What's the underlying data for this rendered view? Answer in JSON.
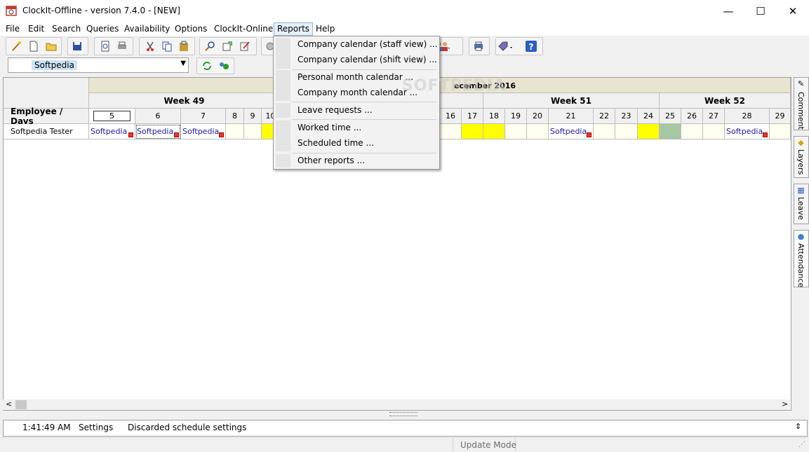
{
  "window": {
    "title": "ClockIt-Offline - version  7.4.0 - [NEW]",
    "minimize": "—",
    "maximize": "☐",
    "close": "✕"
  },
  "menu": [
    "File",
    "Edit",
    "Search",
    "Queries",
    "Availability",
    "Options",
    "ClockIt-Online",
    "Reports",
    "Help"
  ],
  "toolbar_icons": [
    "wand-icon",
    "new-file-icon",
    "open-folder-icon",
    "save-icon",
    "preview-icon",
    "print-icon",
    "cut-icon",
    "copy-icon",
    "paste-icon",
    "find-icon",
    "export-icon",
    "edit-icon",
    "settings-icon",
    "users-icon",
    "printer-icon",
    "tags-icon",
    "help-icon"
  ],
  "employee_selector": {
    "value": "Softpedia"
  },
  "grid": {
    "month_label": "ecember 2016",
    "weeks": [
      "Week 49",
      "Week 51",
      "Week 52"
    ],
    "row_header": "Employee / Days",
    "employee": "Softpedia Tester",
    "days_left": [
      "5",
      "6",
      "7",
      "8",
      "9",
      "10"
    ],
    "days_right": [
      "16",
      "17",
      "18",
      "19",
      "20",
      "21",
      "22",
      "23",
      "24",
      "25",
      "26",
      "27",
      "28",
      "29"
    ],
    "entry": "Softpedia"
  },
  "side_tabs": [
    "Comment",
    "Layers",
    "Leave",
    "Attendance"
  ],
  "reports_menu": [
    "Company calendar (staff view) ...",
    "Company calendar (shift view) ...",
    "Personal month calendar ...",
    "Company month calendar ...",
    "Leave requests ...",
    "Worked time ...",
    "Scheduled time ...",
    "Other reports ..."
  ],
  "status": {
    "time": "1:41:49 AM",
    "category": "Settings",
    "message": "Discarded schedule settings"
  },
  "statusbar": {
    "mode": "Update Mode"
  },
  "watermark": "SOFTPEDIA"
}
